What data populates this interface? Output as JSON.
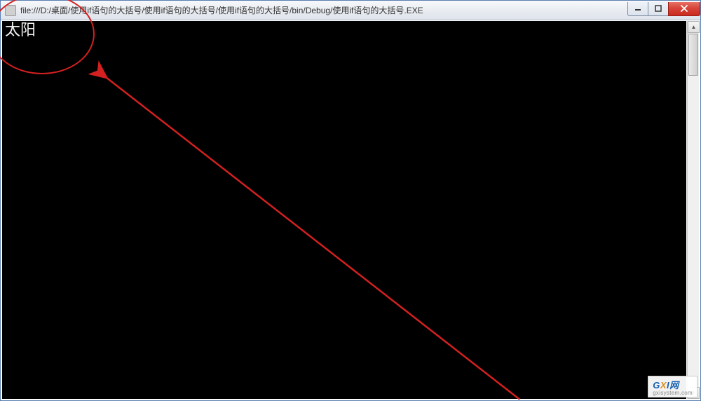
{
  "window": {
    "title": "file:///D:/桌面/使用if语句的大括号/使用if语句的大括号/使用if语句的大括号/bin/Debug/使用if语句的大括号.EXE"
  },
  "console": {
    "output": "太阳"
  },
  "watermark": {
    "brand_g": "G",
    "brand_x": "X",
    "brand_i": "I",
    "brand_net": "网",
    "domain": "gxisystem.com"
  },
  "colors": {
    "annotation": "#d32020",
    "console_bg": "#000000",
    "console_fg": "#f5f5f5",
    "close_btn": "#c92a1e"
  }
}
